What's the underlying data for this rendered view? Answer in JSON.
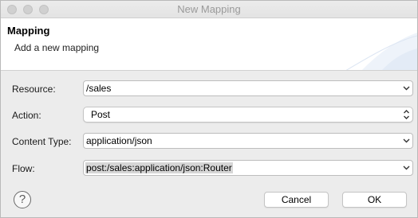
{
  "window": {
    "title": "New Mapping"
  },
  "header": {
    "title": "Mapping",
    "subtitle": "Add a new mapping"
  },
  "form": {
    "resource": {
      "label": "Resource:",
      "value": "/sales"
    },
    "action": {
      "label": "Action:",
      "value": "Post"
    },
    "content_type": {
      "label": "Content Type:",
      "value": "application/json"
    },
    "flow": {
      "label": "Flow:",
      "value": "post:/sales:application/json:Router"
    }
  },
  "footer": {
    "help_glyph": "?",
    "cancel_label": "Cancel",
    "ok_label": "OK"
  },
  "icons": {
    "traffic_lights": [
      "close-icon",
      "minimize-icon",
      "zoom-icon"
    ],
    "combo_arrow": "chevron-down-icon",
    "popup_arrow": "updown-chevron-icon",
    "help": "help-icon"
  }
}
